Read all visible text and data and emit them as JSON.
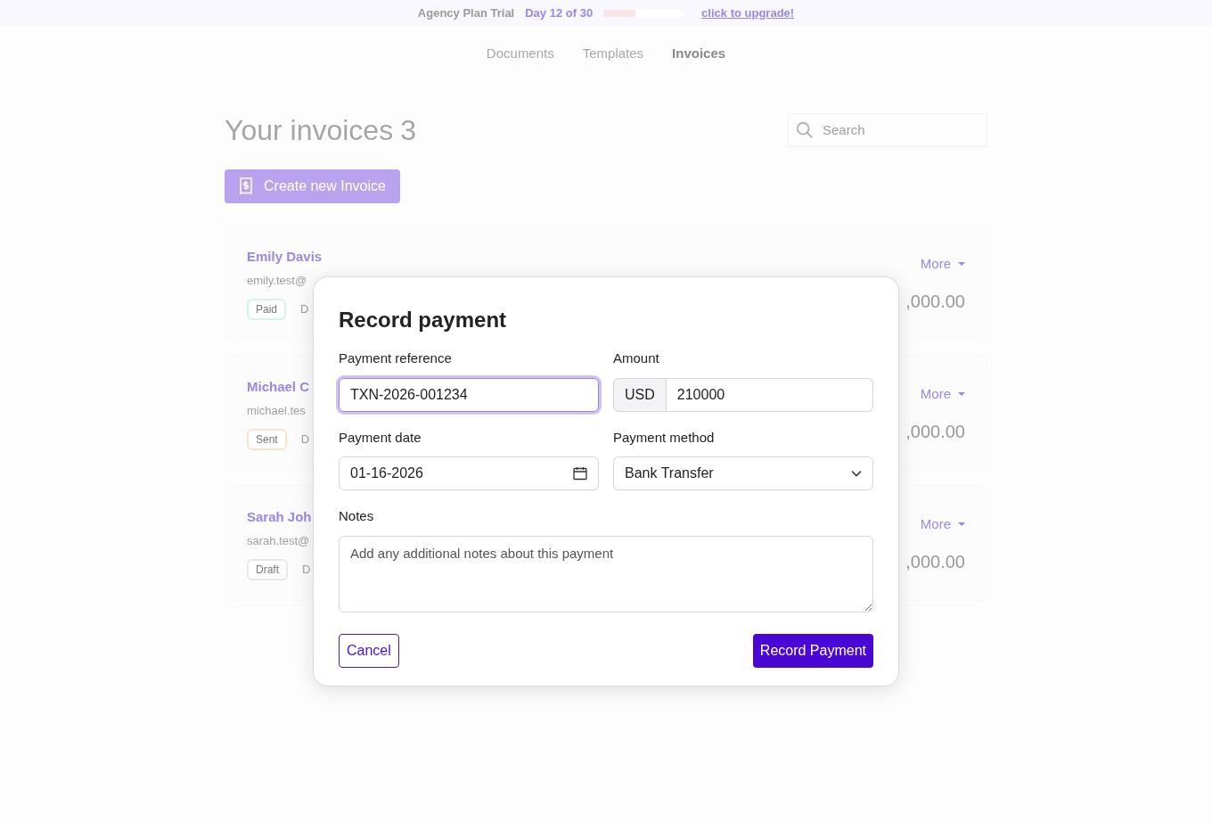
{
  "trial_banner": {
    "plan": "Agency Plan Trial",
    "day": "Day 12 of 30",
    "level": 0.4,
    "upgrade_link": "click to upgrade!"
  },
  "nav_tabs": [
    {
      "label": "Documents",
      "selected": false
    },
    {
      "label": "Templates",
      "selected": false
    },
    {
      "label": "Invoices",
      "selected": true
    }
  ],
  "heading": {
    "title": "Your invoices",
    "count": "3"
  },
  "search": {
    "placeholder": "Search"
  },
  "create_button": "Create new Invoice",
  "invoices": [
    {
      "name": "Emily Davis",
      "email": "emily.test@",
      "status": "Paid",
      "color": "#d1f5e4",
      "due": "D",
      "more": "More",
      "amount": ",000.00"
    },
    {
      "name": "Michael C",
      "email": "michael.tes",
      "status": "Sent",
      "color": "#fde2c8",
      "due": "D",
      "more": "More",
      "amount": ",000.00"
    },
    {
      "name": "Sarah Joh",
      "email": "sarah.test@",
      "status": "Draft",
      "color": "#e5e7eb",
      "due": "D",
      "more": "More",
      "amount": ",000.00"
    }
  ],
  "dialog": {
    "title": "Record payment",
    "reference": {
      "label": "Payment reference",
      "value": "TXN-2026-001234"
    },
    "amount": {
      "label": "Amount",
      "currency": "USD",
      "value": "210000"
    },
    "date": {
      "label": "Payment date",
      "value": "01-16-2026"
    },
    "method": {
      "label": "Payment method",
      "value": "Bank Transfer"
    },
    "notes": {
      "label": "Notes",
      "placeholder": "Add any additional notes about this payment"
    },
    "cancel": "Cancel",
    "submit": "Record Payment"
  }
}
